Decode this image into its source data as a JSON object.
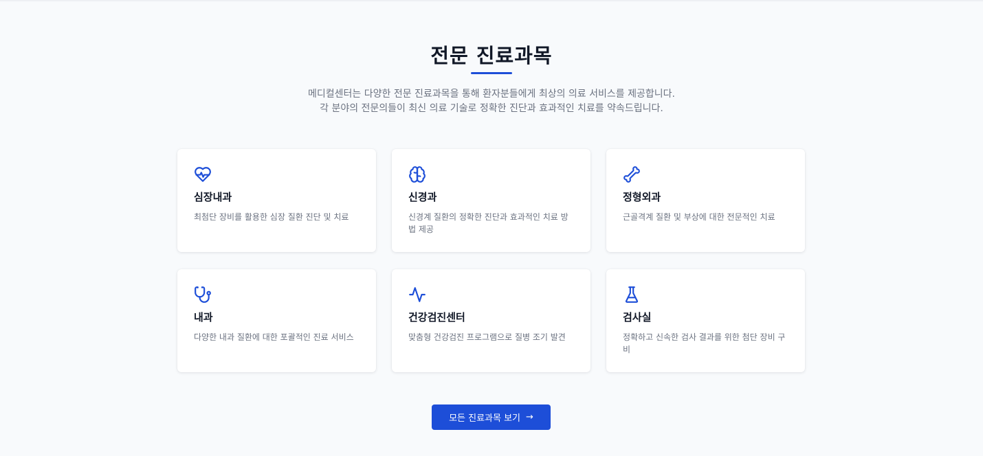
{
  "section": {
    "title": "전문 진료과목",
    "intro_line1": "메디컬센터는 다양한 전문 진료과목을 통해 환자분들에게 최상의 의료 서비스를 제공합니다.",
    "intro_line2": "각 분야의 전문의들이 최신 의료 기술로 정확한 진단과 효과적인 치료를 약속드립니다."
  },
  "departments": [
    {
      "icon": "heart-pulse-icon",
      "title": "심장내과",
      "desc": "최첨단 장비를 활용한 심장 질환 진단 및 치료"
    },
    {
      "icon": "brain-icon",
      "title": "신경과",
      "desc": "신경계 질환의 정확한 진단과 효과적인 치료 방법 제공"
    },
    {
      "icon": "bone-icon",
      "title": "정형외과",
      "desc": "근골격계 질환 및 부상에 대한 전문적인 치료"
    },
    {
      "icon": "stethoscope-icon",
      "title": "내과",
      "desc": "다양한 내과 질환에 대한 포괄적인 진료 서비스"
    },
    {
      "icon": "activity-icon",
      "title": "건강검진센터",
      "desc": "맞춤형 건강검진 프로그램으로 질병 조기 발견"
    },
    {
      "icon": "flask-icon",
      "title": "검사실",
      "desc": "정확하고 신속한 검사 결과를 위한 첨단 장비 구비"
    }
  ],
  "cta": {
    "label": "모든 진료과목 보기",
    "arrow": "→"
  },
  "colors": {
    "accent": "#1d4ed8",
    "background": "#f8fafc",
    "card": "#ffffff",
    "muted_text": "#6b7280"
  }
}
